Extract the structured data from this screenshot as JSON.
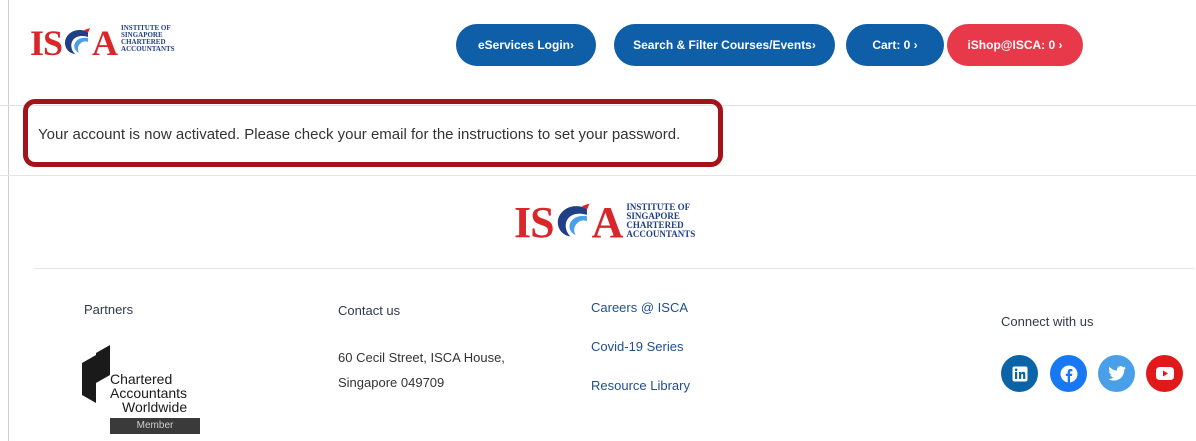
{
  "header": {
    "logo": {
      "letters_left": "IS",
      "letters_right": "A",
      "tagline": [
        "INSTITUTE OF",
        "SINGAPORE",
        "CHARTERED",
        "ACCOUNTANTS"
      ]
    },
    "nav": {
      "eservices": "eServices Login›",
      "search": "Search & Filter Courses/Events›",
      "cart": "Cart: 0 ›",
      "ishop": "iShop@ISCA: 0 ›"
    },
    "colors": {
      "primary": "#0f5ea8",
      "ishop": "#e8394a",
      "brand_red": "#d8262b",
      "brand_blue": "#1f3f86"
    }
  },
  "message": {
    "text": "Your account is now activated. Please check your email for the instructions to set your password.",
    "highlight_color": "#a3131c"
  },
  "footer": {
    "logo": {
      "letters_left": "IS",
      "letters_right": "A",
      "tagline": [
        "INSTITUTE OF",
        "SINGAPORE",
        "CHARTERED",
        "ACCOUNTANTS"
      ]
    },
    "partners": {
      "title": "Partners",
      "caw_lines": [
        "Chartered",
        "Accountants",
        "Worldwide"
      ],
      "caw_member": "Member"
    },
    "contact": {
      "title": "Contact us",
      "address_line1": "60 Cecil Street, ISCA House,",
      "address_line2": "Singapore 049709"
    },
    "links": {
      "careers": "Careers @ ISCA",
      "covid": "Covid-19 Series",
      "resource": "Resource Library"
    },
    "connect": {
      "title": "Connect with us",
      "icons": [
        "linkedin-icon",
        "facebook-icon",
        "twitter-icon",
        "youtube-icon"
      ]
    }
  }
}
